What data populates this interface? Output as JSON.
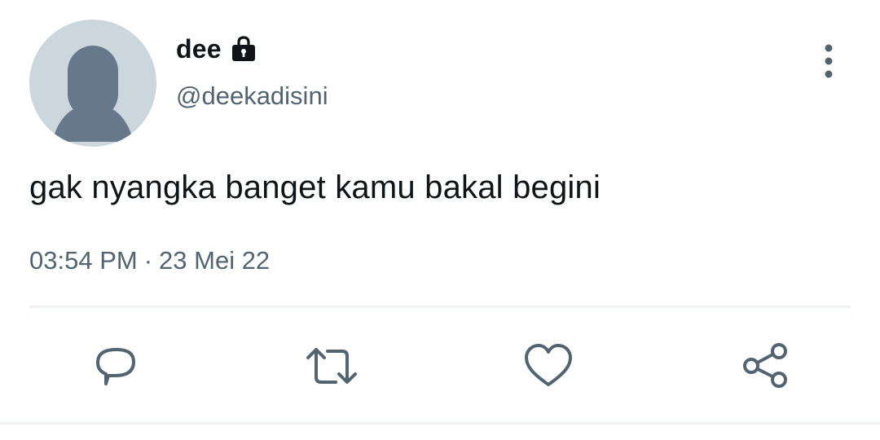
{
  "user": {
    "display_name": "dee",
    "handle": "@deekadisini",
    "protected_icon": "lock-icon",
    "avatar": "default-avatar"
  },
  "tweet": {
    "text": "gak nyangka banget kamu bakal begini",
    "time": "03:54 PM",
    "separator": "·",
    "date": "23 Mei 22"
  },
  "actions": [
    {
      "name": "reply",
      "icon": "reply-icon"
    },
    {
      "name": "retweet",
      "icon": "retweet-icon"
    },
    {
      "name": "like",
      "icon": "heart-icon"
    },
    {
      "name": "share",
      "icon": "share-icon"
    }
  ],
  "menu": {
    "icon": "more-vertical-icon"
  },
  "colors": {
    "text": "#0f1419",
    "secondary": "#536471",
    "avatar_bg": "#ccd6dd",
    "avatar_fg": "#66788a",
    "divider": "#eff3f4"
  }
}
